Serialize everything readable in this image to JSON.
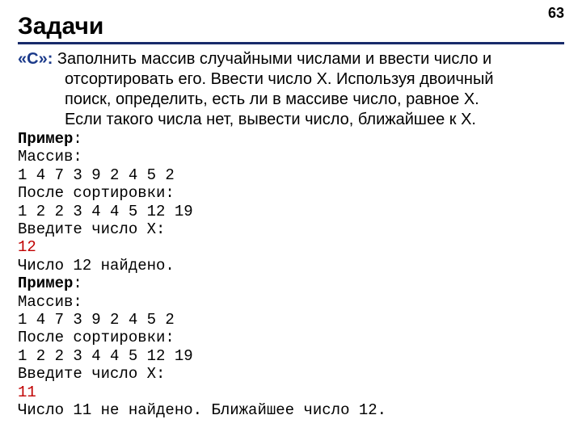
{
  "page_number": "63",
  "title": "Задачи",
  "task": {
    "level_label": "«C»:",
    "line1_after": " Заполнить массив случайными числами и ввести число и",
    "line2": "отсортировать его.  Ввести число X. Используя двоичный",
    "line3": "поиск, определить, есть ли в массиве число, равное X.",
    "line4": "Если такого числа нет, вывести число, ближайшее к X."
  },
  "example1": {
    "header": "Пример",
    "colon": ":",
    "arr_label": "Массив:",
    "arr_values": "1 4 7 3 9 2 4 5 2",
    "sorted_label": "После сортировки:",
    "sorted_values": "1 2 2 3 4 4 5 12 19",
    "prompt": "Введите число X:",
    "x_value": "12",
    "result": "Число 12 найдено."
  },
  "example2": {
    "header": "Пример",
    "colon": ":",
    "arr_label": "Массив:",
    "arr_values": "1 4 7 3 9 2 4 5 2",
    "sorted_label": "После сортировки:",
    "sorted_values": "1 2 2 3 4 4 5 12 19",
    "prompt": "Введите число X:",
    "x_value": "11",
    "result": "Число 11 не найдено. Ближайшее число 12."
  }
}
